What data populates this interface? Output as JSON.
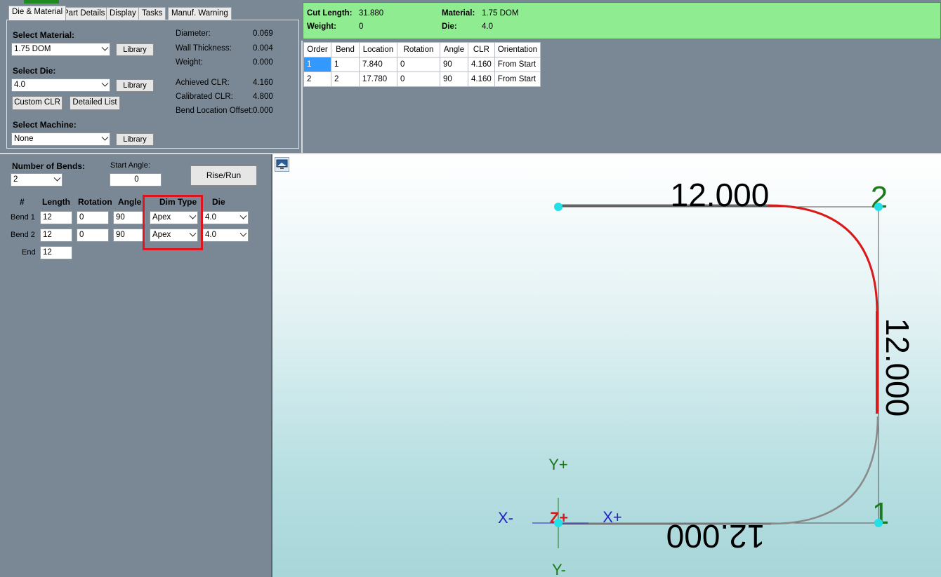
{
  "tabs": [
    "Die & Material",
    "Part Details",
    "Display",
    "Tasks",
    "Manuf. Warning"
  ],
  "die_material": {
    "select_material_label": "Select Material:",
    "material_value": "1.75 DOM",
    "library_label": "Library",
    "select_die_label": "Select Die:",
    "die_value": "4.0",
    "custom_clr_label": "Custom CLR",
    "detailed_list_label": "Detailed List",
    "select_machine_label": "Select Machine:",
    "machine_value": "None",
    "props": [
      {
        "label": "Diameter:",
        "value": "0.069"
      },
      {
        "label": "Wall Thickness:",
        "value": "0.004"
      },
      {
        "label": "Weight:",
        "value": "0.000"
      },
      {
        "label": "Achieved CLR:",
        "value": "4.160"
      },
      {
        "label": "Calibrated CLR:",
        "value": "4.800"
      },
      {
        "label": "Bend Location Offset:",
        "value": "0.000"
      }
    ]
  },
  "summary": {
    "cut_length_label": "Cut Length:",
    "cut_length_value": "31.880",
    "weight_label": "Weight:",
    "weight_value": "0",
    "material_label": "Material:",
    "material_value": "1.75 DOM",
    "die_label": "Die:",
    "die_value": "4.0"
  },
  "bend_table": {
    "headers": [
      "Order",
      "Bend",
      "Location",
      "Rotation",
      "Angle",
      "CLR",
      "Orientation"
    ],
    "rows": [
      [
        "1",
        "1",
        "7.840",
        "0",
        "90",
        "4.160",
        "From Start"
      ],
      [
        "2",
        "2",
        "17.780",
        "0",
        "90",
        "4.160",
        "From Start"
      ]
    ]
  },
  "editor": {
    "num_bends_label": "Number of Bends:",
    "num_bends_value": "2",
    "start_angle_label": "Start Angle:",
    "start_angle_value": "0",
    "rise_run_label": "Rise/Run",
    "col_headers": [
      "#",
      "Length",
      "Rotation",
      "Angle",
      "Dim Type",
      "Die"
    ],
    "rows": [
      {
        "name": "Bend 1",
        "length": "12",
        "rotation": "0",
        "angle": "90",
        "dim_type": "Apex",
        "die": "4.0"
      },
      {
        "name": "Bend 2",
        "length": "12",
        "rotation": "0",
        "angle": "90",
        "dim_type": "Apex",
        "die": "4.0"
      }
    ],
    "end_label": "End",
    "end_value": "12"
  },
  "viewport": {
    "dim_top": "12.000",
    "dim_right": "12.000",
    "dim_bottom": "12.000",
    "bend_label_1": "1",
    "bend_label_2": "2",
    "axis_y_plus": "Y+",
    "axis_y_minus": "Y-",
    "axis_x_plus": "X+",
    "axis_x_minus": "X-",
    "axis_z_plus": "Z+"
  },
  "colors": {
    "info_bg": "#90ec90",
    "panel_bg": "#7a8896",
    "highlight": "#e0141e",
    "bend_red": "#d91a1a",
    "node_cyan": "#22e0e6"
  }
}
